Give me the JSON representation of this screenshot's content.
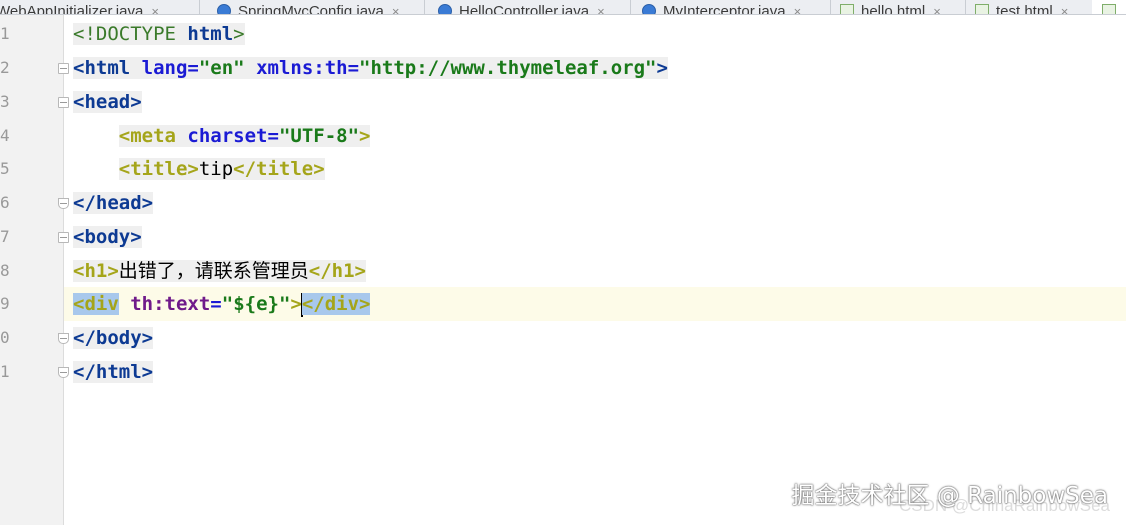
{
  "tabs": [
    {
      "label": "WebAppInitializer.java",
      "icon": "java-class-icon"
    },
    {
      "label": "SpringMvcConfig.java",
      "icon": "java-class-icon"
    },
    {
      "label": "HelloController.java",
      "icon": "java-class-icon"
    },
    {
      "label": "MyInterceptor.java",
      "icon": "java-class-icon"
    },
    {
      "label": "hello.html",
      "icon": "html-file-icon"
    },
    {
      "label": "test.html",
      "icon": "html-file-icon"
    },
    {
      "label": "",
      "icon": "html-file-icon"
    }
  ],
  "line_numbers": [
    "1",
    "2",
    "3",
    "4",
    "5",
    "6",
    "7",
    "8",
    "9",
    "0",
    "1"
  ],
  "code": {
    "l1": {
      "a": "<!DOCTYPE ",
      "b": "html",
      "c": ">"
    },
    "l2": {
      "t1": "<html ",
      "a1": "lang",
      "e1": "=",
      "s1": "\"en\"",
      "sp": " ",
      "a2": "xmlns:th",
      "e2": "=",
      "s2": "\"http://www.thymeleaf.org\"",
      "t2": ">"
    },
    "l3": {
      "t": "<head>"
    },
    "l4": {
      "indent": "    ",
      "t1": "<meta ",
      "a1": "charset",
      "e1": "=",
      "s1": "\"UTF-8\"",
      "t2": ">"
    },
    "l5": {
      "indent": "    ",
      "t1": "<title>",
      "x": "tip",
      "t2": "</title>"
    },
    "l6": {
      "t": "</head>"
    },
    "l7": {
      "t": "<body>"
    },
    "l8": {
      "t1": "<h1>",
      "x": "出错了，请联系管理员",
      "t2": "</h1>"
    },
    "l9": {
      "t1": "<div",
      "sp": " ",
      "a1": "th:text",
      "e1": "=",
      "s1": "\"${e}\"",
      "t2": ">",
      "t3": "</div>"
    },
    "l10": {
      "t": "</body>"
    },
    "l11": {
      "t": "</html>"
    }
  },
  "watermark": {
    "primary": "掘金技术社区 @ RainbowSea",
    "secondary": "CSDN @ChinaRainbowSea"
  },
  "colors": {
    "tag": "#0d3a93",
    "tag_html_highlight": "#a5a51a",
    "attribute": "#1b1bd4",
    "thymeleaf_attribute": "#701a8a",
    "string": "#1a7a1a",
    "selection": "#a8c8ec",
    "current_line": "#fdfbe8"
  }
}
